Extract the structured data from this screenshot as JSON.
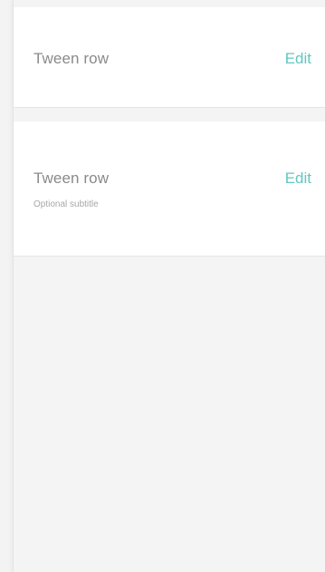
{
  "rows": [
    {
      "title": "Tween row",
      "action": "Edit",
      "subtitle": ""
    },
    {
      "title": "Tween row",
      "action": "Edit",
      "subtitle": "Optional subtitle"
    }
  ],
  "colors": {
    "accent": "#62c7c1",
    "background": "#f4f4f4",
    "card": "#ffffff",
    "title_text": "#8a8a8a",
    "subtitle_text": "#a7a7a7"
  }
}
